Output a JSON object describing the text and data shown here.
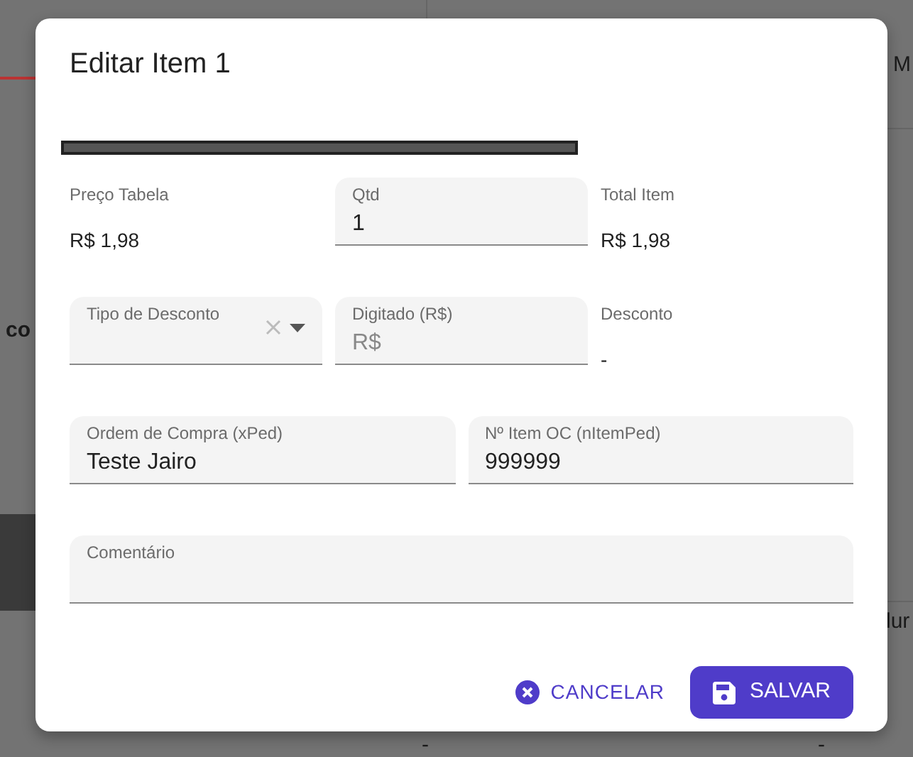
{
  "background": {
    "texts": [
      "M",
      "co",
      "lur",
      "-",
      "-"
    ]
  },
  "dialog": {
    "title": "Editar Item 1",
    "sections": [
      {
        "fields": [
          {
            "kind": "readonly",
            "label": "Preço Tabela",
            "value": "R$ 1,98"
          },
          {
            "kind": "input",
            "label": "Qtd",
            "value": "1"
          },
          {
            "kind": "readonly",
            "label": "Total Item",
            "value": "R$ 1,98"
          }
        ]
      },
      {
        "fields": [
          {
            "kind": "select",
            "label": "Tipo de Desconto"
          },
          {
            "kind": "input",
            "label": "Digitado (R$)",
            "placeholder": "R$"
          },
          {
            "kind": "readonly",
            "label": "Desconto",
            "value": "-"
          }
        ]
      },
      {
        "fields": [
          {
            "kind": "input",
            "label": "Ordem de Compra (xPed)",
            "value": "Teste Jairo"
          },
          {
            "kind": "input",
            "label": "Nº Item OC (nItemPed)",
            "value": "999999"
          }
        ]
      },
      {
        "fields": [
          {
            "kind": "input",
            "label": "Comentário"
          }
        ]
      }
    ],
    "buttons": [
      {
        "kind": "text",
        "label": "CANCELAR"
      },
      {
        "kind": "primary",
        "label": "SALVAR"
      }
    ]
  }
}
